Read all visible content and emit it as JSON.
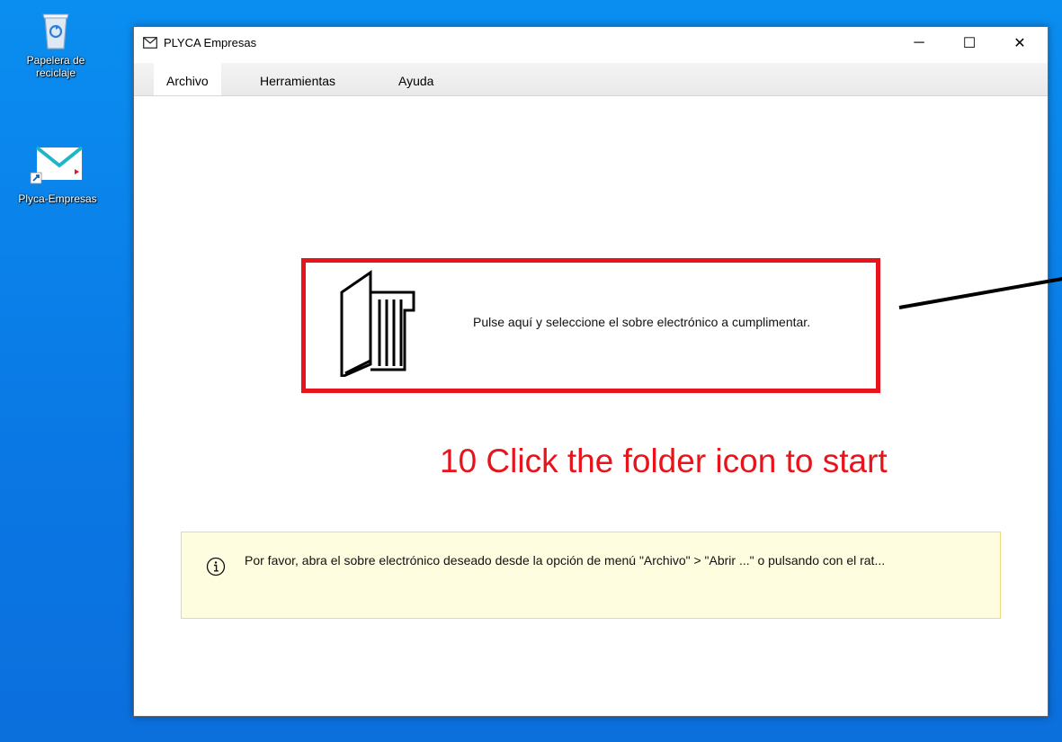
{
  "desktop": {
    "icons": [
      {
        "label_line1": "Papelera de",
        "label_line2": "reciclaje",
        "icon": "recycle-bin-icon"
      },
      {
        "label": "Plyca-Empresas",
        "icon": "envelope-shortcut-icon"
      }
    ]
  },
  "window": {
    "title": "PLYCA Empresas",
    "controls": {
      "minimize": "─",
      "maximize": "☐",
      "close": "✕"
    }
  },
  "menubar": {
    "items": [
      {
        "label": "Archivo",
        "active": true
      },
      {
        "label": "Herramientas",
        "active": false
      },
      {
        "label": "Ayuda",
        "active": false
      }
    ]
  },
  "main": {
    "open_prompt": "Pulse aquí y seleccione el sobre electrónico a cumplimentar.",
    "caption": "10 Click the folder icon to start",
    "info": "Por favor, abra el sobre electrónico deseado desde la opción de menú \"Archivo\" > \"Abrir ...\" o pulsando con el rat..."
  },
  "colors": {
    "desktop_blue": "#0a84ee",
    "highlight_red": "#e8141b",
    "info_bg": "#fffde0"
  }
}
